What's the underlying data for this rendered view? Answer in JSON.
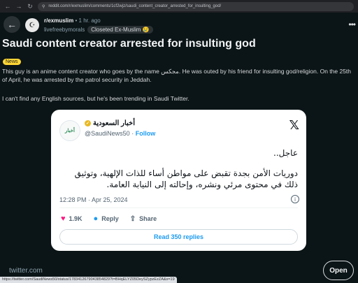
{
  "browser": {
    "url": "reddit.com/r/exmuslim/comments/1cf2wjz/saudi_content_creator_arrested_for_insulting_god/",
    "back_glyph": "←",
    "forward_glyph": "→",
    "reload_glyph": "↻",
    "lock_glyph": "⚲"
  },
  "post": {
    "back_glyph": "←",
    "subreddit": "r/exmuslim",
    "separator": "•",
    "time": "1 hr. ago",
    "author": "livefreebymorals",
    "author_flair": "Closeted Ex-Muslim 😢",
    "more_glyph": "•••",
    "title": "Saudi content creator arrested for insulting god",
    "post_flair": "News",
    "paragraph1": "This guy is an anime content creator who goes by the name مجكس. He was outed by his friend for insulting god/religion. On the 25th of April, he was arrested by the patrol security in Jeddah.",
    "paragraph2": "I can't find any English sources, but he's been trending in Saudi Twitter."
  },
  "tweet": {
    "avatar_text": "أخبار",
    "display_name": "أخبار السعودية",
    "handle": "@SaudiNews50",
    "handle_sep": "·",
    "follow_label": "Follow",
    "x_glyph": "𝕏",
    "text_line1": "عاجل..",
    "text_line2": "دوريات الأمن بجدة تقبض على مواطن أساء للذات الإلهية، وتوثيق ذلك في محتوى مرئي ونشره، وإحالته إلى النيابة العامة.",
    "timestamp": "12:28 PM · Apr 25, 2024",
    "info_glyph": "i",
    "likes": "1.9K",
    "reply_label": "Reply",
    "share_label": "Share",
    "read_replies_label": "Read 350 replies"
  },
  "link": {
    "domain": "twitter.com",
    "open_label": "Open"
  },
  "status_bar": {
    "url": "https://twitter.com/SaudiNews50/status/1783412679043854829?t=BHqELYZ05DeySZypzEzZA&s=19"
  },
  "colors": {
    "background": "#0b1416",
    "news_flair": "#ffd635",
    "twitter_blue": "#1d9bf0",
    "like_pink": "#f91880"
  }
}
